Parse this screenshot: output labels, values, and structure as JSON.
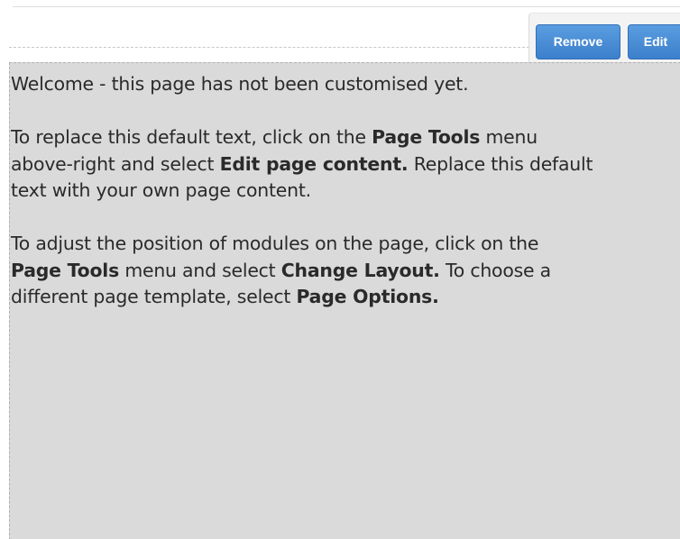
{
  "toolbar": {
    "remove_label": "Remove",
    "edit_label": "Edit"
  },
  "content": {
    "p1": "Welcome - this page has not been customised yet.",
    "p2": {
      "t1": "To replace this default text, click on the ",
      "b1": "Page Tools",
      "t2": " menu",
      "t3": "above-right and select ",
      "b2": "Edit page content.",
      "t4": " Replace this default",
      "t5": "text with your own page content."
    },
    "p3": {
      "t1": "To adjust the position of modules on the page, click on the",
      "b1": "Page Tools",
      "t2": " menu and select ",
      "b2": "Change Layout.",
      "t3": " To choose a",
      "t4": "different page template, select ",
      "b3": "Page Options."
    }
  },
  "colors": {
    "button_blue": "#428bd6",
    "panel_gray": "#dadada",
    "text": "#2a2a2a"
  }
}
